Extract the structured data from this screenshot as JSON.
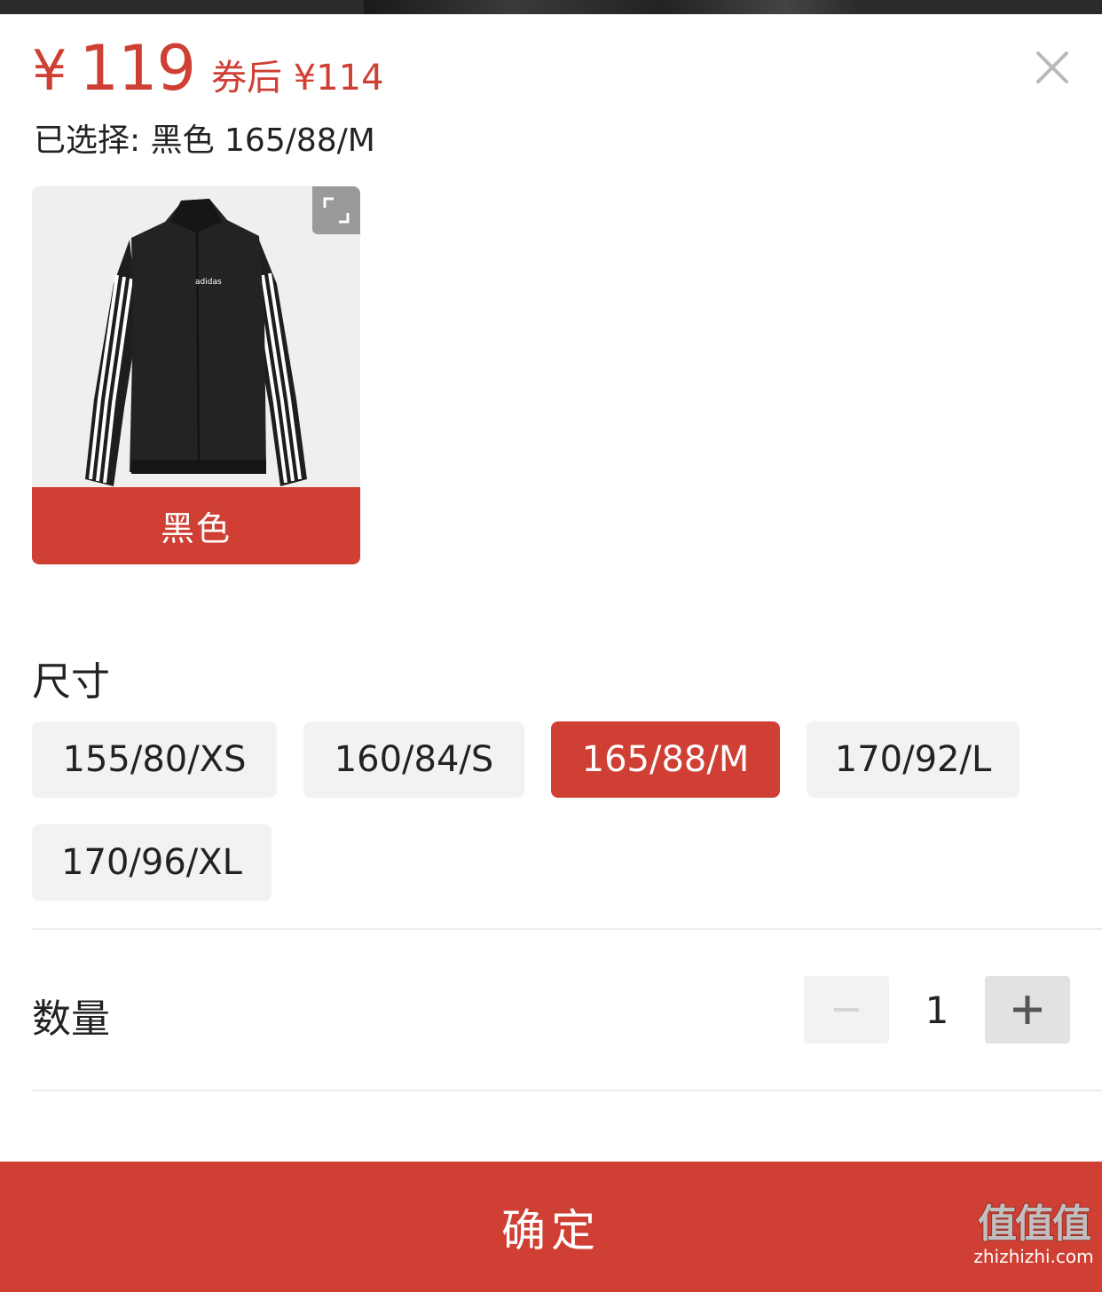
{
  "header": {
    "currency_symbol": "¥",
    "price": "119",
    "coupon_price": "券后 ¥114",
    "selected_text": "已选择: 黑色 165/88/M"
  },
  "colors": {
    "accent": "#cf3f33",
    "chip_bg": "#f2f2f2"
  },
  "color_option": {
    "label": "黑色",
    "product_image": "adidas black track jacket",
    "logo_text": "adidas"
  },
  "size_section": {
    "title": "尺寸",
    "options": [
      "155/80/XS",
      "160/84/S",
      "165/88/M",
      "170/92/L",
      "170/96/XL"
    ],
    "selected": "165/88/M"
  },
  "quantity": {
    "label": "数量",
    "value": "1",
    "minus_icon": "minus-icon",
    "plus_icon": "plus-icon"
  },
  "confirm_label": "确定",
  "watermark": {
    "big": "值值值",
    "small": "zhizhizhi.com"
  }
}
